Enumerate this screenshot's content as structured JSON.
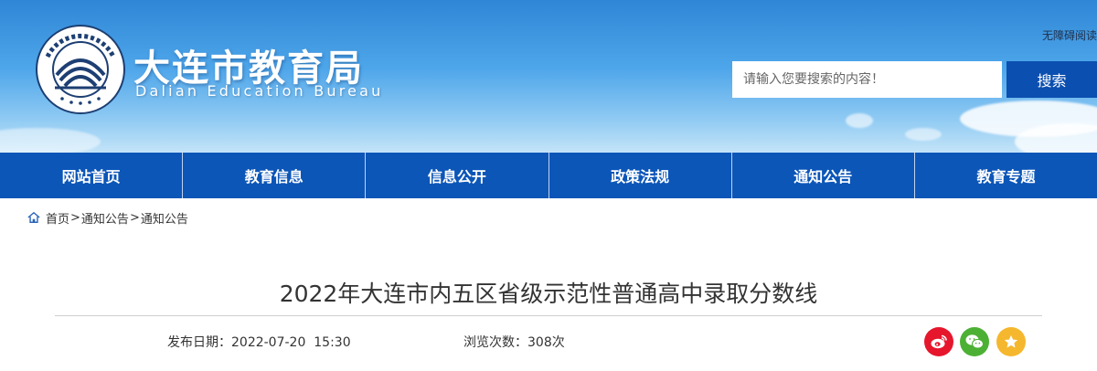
{
  "header": {
    "title": "大连市教育局",
    "subtitle": "Dalian Education Bureau",
    "logo_icon": "bureau-seal-icon",
    "accessible_label": "无障碍阅读",
    "search": {
      "placeholder": "请输入您要搜索的内容！",
      "button_label": "搜索"
    }
  },
  "nav": {
    "items": [
      {
        "label": "网站首页"
      },
      {
        "label": "教育信息"
      },
      {
        "label": "信息公开"
      },
      {
        "label": "政策法规"
      },
      {
        "label": "通知公告"
      },
      {
        "label": "教育专题"
      }
    ]
  },
  "breadcrumb": {
    "home_icon": "home-icon",
    "items": [
      "首页",
      "通知公告",
      "通知公告"
    ],
    "separator": ">"
  },
  "article": {
    "title": "2022年大连市内五区省级示范性普通高中录取分数线",
    "publish_label": "发布日期：",
    "publish_value": "2022-07-20  15:30",
    "views_label": "浏览次数：",
    "views_value": "308次"
  },
  "share": [
    {
      "icon": "weibo-icon",
      "color": "#e6162d"
    },
    {
      "icon": "wechat-icon",
      "color": "#4cb034"
    },
    {
      "icon": "favorite-star-icon",
      "color": "#f5b72d"
    }
  ],
  "colors": {
    "nav_bg": "#0c56b8",
    "search_button": "#0b4fb0",
    "header_sky": "#4ea6ea"
  }
}
